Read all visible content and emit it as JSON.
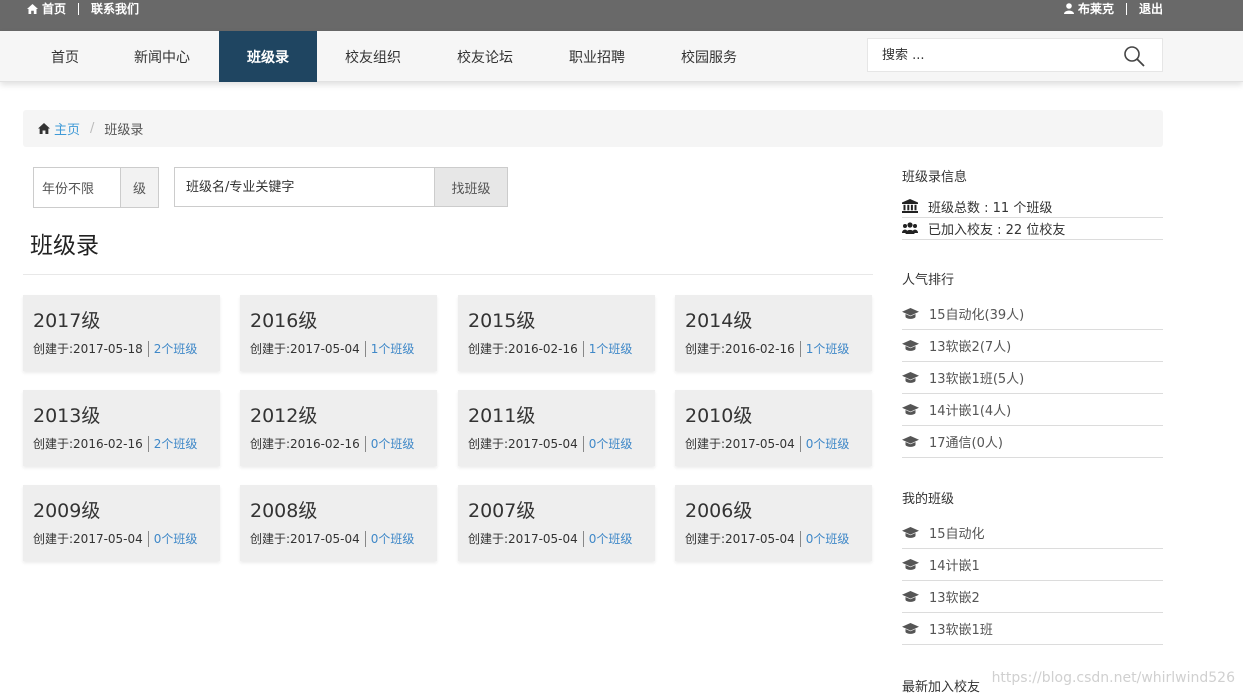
{
  "topbar": {
    "home": "首页",
    "contact": "联系我们",
    "user": "布莱克",
    "logout": "退出"
  },
  "nav": {
    "items": [
      "首页",
      "新闻中心",
      "班级录",
      "校友组织",
      "校友论坛",
      "职业招聘",
      "校园服务"
    ],
    "active": "班级录",
    "search_placeholder": "搜索 ..."
  },
  "breadcrumb": {
    "home": "主页",
    "current": "班级录"
  },
  "filter": {
    "year": "年份不限",
    "year_suffix": "级",
    "keyword_placeholder": "班级名/专业关键字",
    "button": "找班级"
  },
  "page_title": "班级录",
  "cards": [
    {
      "year": "2017级",
      "created": "创建于:2017-05-18",
      "count": "2个班级"
    },
    {
      "year": "2016级",
      "created": "创建于:2017-05-04",
      "count": "1个班级"
    },
    {
      "year": "2015级",
      "created": "创建于:2016-02-16",
      "count": "1个班级"
    },
    {
      "year": "2014级",
      "created": "创建于:2016-02-16",
      "count": "1个班级"
    },
    {
      "year": "2013级",
      "created": "创建于:2016-02-16",
      "count": "2个班级"
    },
    {
      "year": "2012级",
      "created": "创建于:2016-02-16",
      "count": "0个班级"
    },
    {
      "year": "2011级",
      "created": "创建于:2017-05-04",
      "count": "0个班级"
    },
    {
      "year": "2010级",
      "created": "创建于:2017-05-04",
      "count": "0个班级"
    },
    {
      "year": "2009级",
      "created": "创建于:2017-05-04",
      "count": "0个班级"
    },
    {
      "year": "2008级",
      "created": "创建于:2017-05-04",
      "count": "0个班级"
    },
    {
      "year": "2007级",
      "created": "创建于:2017-05-04",
      "count": "0个班级"
    },
    {
      "year": "2006级",
      "created": "创建于:2017-05-04",
      "count": "0个班级"
    }
  ],
  "sidebar": {
    "info_title": "班级录信息",
    "info": [
      "班级总数 : 11 个班级",
      "已加入校友 : 22 位校友"
    ],
    "popular_title": "人气排行",
    "popular": [
      "15自动化(39人)",
      "13软嵌2(7人)",
      "13软嵌1班(5人)",
      "14计嵌1(4人)",
      "17通信(0人)"
    ],
    "mine_title": "我的班级",
    "mine": [
      "15自动化",
      "14计嵌1",
      "13软嵌2",
      "13软嵌1班"
    ],
    "latest_title": "最新加入校友"
  },
  "watermark": "https://blog.csdn.net/whirlwind526"
}
